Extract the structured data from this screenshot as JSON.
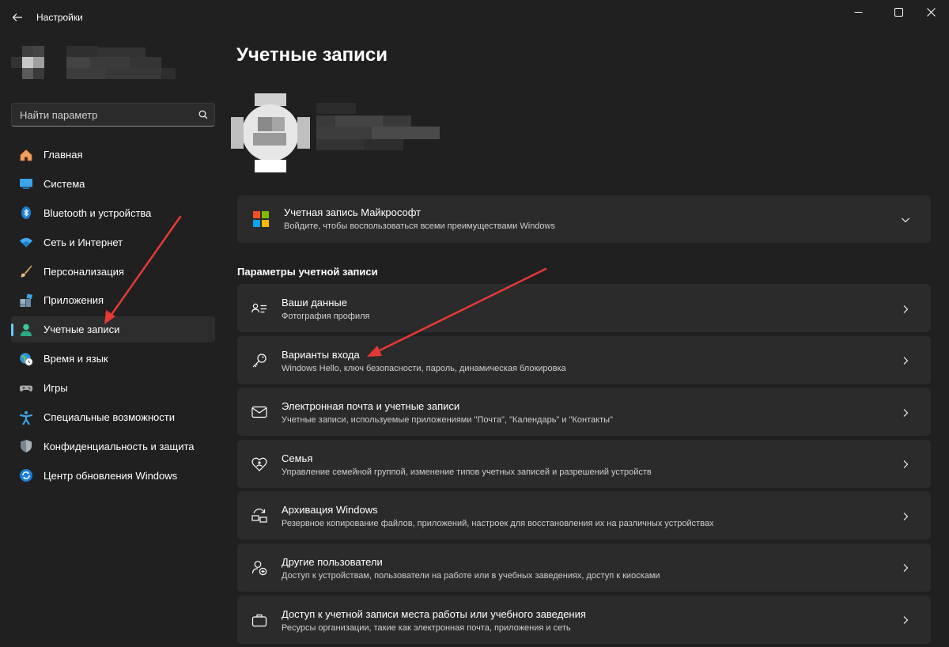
{
  "window": {
    "title": "Настройки"
  },
  "search": {
    "placeholder": "Найти параметр"
  },
  "sidebar": {
    "items": [
      {
        "label": "Главная",
        "icon": "home-icon"
      },
      {
        "label": "Система",
        "icon": "system-icon"
      },
      {
        "label": "Bluetooth и устройства",
        "icon": "bluetooth-icon"
      },
      {
        "label": "Сеть и Интернет",
        "icon": "wifi-icon"
      },
      {
        "label": "Персонализация",
        "icon": "brush-icon"
      },
      {
        "label": "Приложения",
        "icon": "apps-icon"
      },
      {
        "label": "Учетные записи",
        "icon": "account-icon",
        "active": true
      },
      {
        "label": "Время и язык",
        "icon": "globe-clock-icon"
      },
      {
        "label": "Игры",
        "icon": "gamepad-icon"
      },
      {
        "label": "Специальные возможности",
        "icon": "accessibility-icon"
      },
      {
        "label": "Конфиденциальность и защита",
        "icon": "shield-icon"
      },
      {
        "label": "Центр обновления Windows",
        "icon": "update-icon"
      }
    ]
  },
  "main": {
    "title": "Учетные записи",
    "microsoft_account": {
      "title": "Учетная запись Майкрософт",
      "subtitle": "Войдите, чтобы воспользоваться всеми преимуществами Windows"
    },
    "section_title": "Параметры учетной записи",
    "settings": [
      {
        "title": "Ваши данные",
        "subtitle": "Фотография профиля",
        "icon": "user-info-icon"
      },
      {
        "title": "Варианты входа",
        "subtitle": "Windows Hello, ключ безопасности, пароль, динамическая блокировка",
        "icon": "key-icon"
      },
      {
        "title": "Электронная почта и учетные записи",
        "subtitle": "Учетные записи, используемые приложениями \"Почта\", \"Календарь\" и \"Контакты\"",
        "icon": "mail-icon"
      },
      {
        "title": "Семья",
        "subtitle": "Управление семейной группой, изменение типов учетных записей и разрешений устройств",
        "icon": "family-icon"
      },
      {
        "title": "Архивация Windows",
        "subtitle": "Резервное копирование файлов, приложений, настроек для восстановления их на различных устройствах",
        "icon": "backup-icon"
      },
      {
        "title": "Другие пользователи",
        "subtitle": "Доступ к устройствам, пользователи на работе или в учебных заведениях, доступ к киосками",
        "icon": "other-users-icon"
      },
      {
        "title": "Доступ к учетной записи места работы или учебного заведения",
        "subtitle": "Ресурсы организации, такие как электронная почта, приложения и сеть",
        "icon": "briefcase-icon"
      }
    ]
  },
  "colors": {
    "background": "#202020",
    "card": "#2b2b2b",
    "accent": "#60cdff",
    "annotation": "#e53935"
  }
}
